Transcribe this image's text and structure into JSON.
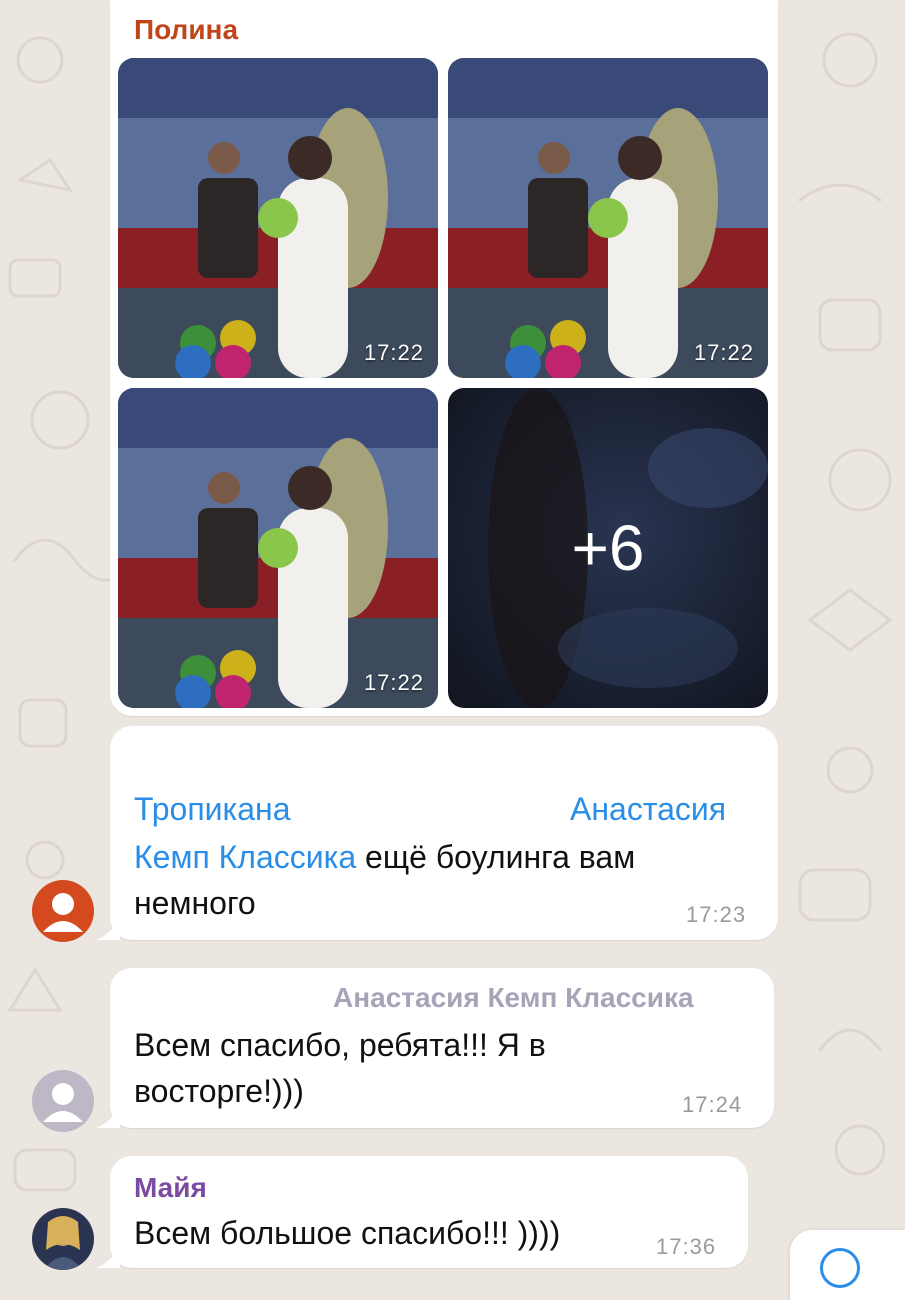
{
  "messages": [
    {
      "sender": "Полина",
      "sender_color": "#c0451b",
      "photos": [
        {
          "time": "17:22"
        },
        {
          "time": "17:22"
        },
        {
          "time": "17:22"
        },
        {
          "more_label": "+6"
        }
      ]
    },
    {
      "mention_1": "Тропикана",
      "mention_2": "Анастасия",
      "mention_3": "Кемп Классика",
      "text": "ещё боулинга вам",
      "text_2": "немного",
      "time": "17:23",
      "avatar_color": "#d44a1e"
    },
    {
      "sender": "Анастасия Кемп Классика",
      "sender_color": "#a8a3b6",
      "text_line1": "Всем спасибо, ребята!!! Я в",
      "text_line2": "восторге!)))",
      "time": "17:24",
      "avatar_color": "#bdb7c6"
    },
    {
      "sender": "Майя",
      "sender_color": "#7b4aa1",
      "text": "Всем большое спасибо!!! ))))",
      "time": "17:36"
    }
  ],
  "accent_color": "#2a8ee8"
}
